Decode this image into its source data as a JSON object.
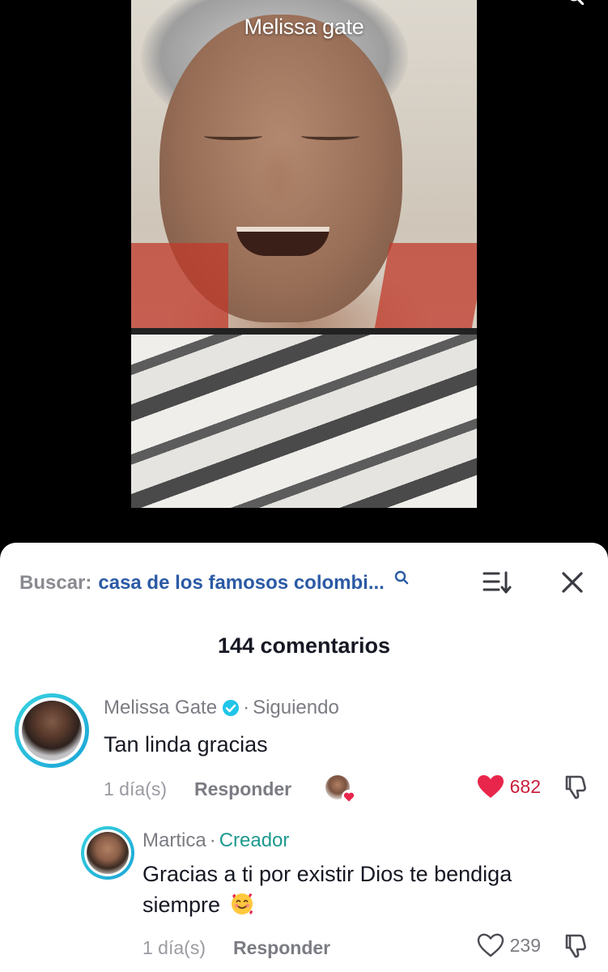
{
  "video": {
    "title": "Melissa gate"
  },
  "comments_panel": {
    "search_prefix": "Buscar:",
    "search_term": "casa de los famosos colombi...",
    "count_label": "144 comentarios"
  },
  "comments": [
    {
      "author": "Melissa Gate",
      "verified": true,
      "relation": "Siguiendo",
      "separator": "·",
      "text": "Tan linda gracias",
      "time": "1 día(s)",
      "reply_label": "Responder",
      "liked_by_creator": true,
      "likes": "682",
      "liked": true
    },
    {
      "author": "Martica",
      "separator": "·",
      "tag": "Creador",
      "text": "Gracias a ti por existir Dios te bendiga siempre",
      "emoji": "smiling-face-with-hearts",
      "time": "1 día(s)",
      "reply_label": "Responder",
      "likes": "239",
      "liked": false
    }
  ],
  "colors": {
    "liked_heart": "#e8264b",
    "verified_badge": "#20c5e8",
    "search_term": "#2b5aa5",
    "creator_tag": "#1e9a8f"
  }
}
